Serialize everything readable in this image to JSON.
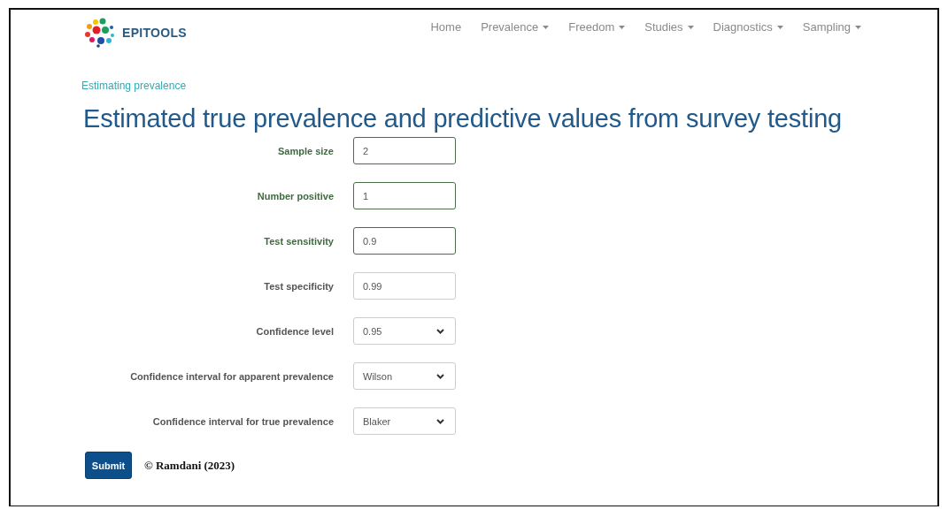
{
  "logo": {
    "text": "EPITOOLS"
  },
  "nav": [
    {
      "label": "Home",
      "dropdown": false
    },
    {
      "label": "Prevalence",
      "dropdown": true
    },
    {
      "label": "Freedom",
      "dropdown": true
    },
    {
      "label": "Studies",
      "dropdown": true
    },
    {
      "label": "Diagnostics",
      "dropdown": true
    },
    {
      "label": "Sampling",
      "dropdown": true
    }
  ],
  "breadcrumb": "Estimating prevalence",
  "heading": "Estimated true prevalence and predictive values from survey testing",
  "fields": [
    {
      "label": "Sample size",
      "kind": "input",
      "value": "2",
      "valid": true
    },
    {
      "label": "Number positive",
      "kind": "input",
      "value": "1",
      "valid": true
    },
    {
      "label": "Test sensitivity",
      "kind": "input",
      "value": "0.9",
      "valid": true
    },
    {
      "label": "Test specificity",
      "kind": "input",
      "value": "0.99",
      "valid": false
    },
    {
      "label": "Confidence level",
      "kind": "select",
      "value": "0.95",
      "valid": false
    },
    {
      "label": "Confidence interval for apparent prevalence",
      "kind": "select",
      "value": "Wilson",
      "valid": false
    },
    {
      "label": "Confidence interval for true prevalence",
      "kind": "select",
      "value": "Blaker",
      "valid": false
    }
  ],
  "submit": "Submit",
  "copyright": "© Ramdani (2023)"
}
